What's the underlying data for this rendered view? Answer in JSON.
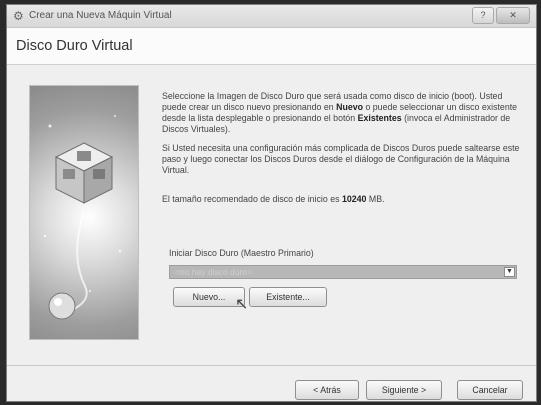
{
  "window": {
    "title": "Crear una Nueva Máquin Virtual",
    "controls": {
      "help": "?",
      "close": "✕"
    }
  },
  "page": {
    "title": "Disco Duro Virtual"
  },
  "description": {
    "p1": [
      "Seleccione la Imagen de Disco Duro que será usada como disco de inicio (boot).",
      "Usted puede crear un disco nuevo presionando en ",
      "Nuevo",
      " o puede seleccionar un disco existente desde la lista desplegable o presionando el botón ",
      "Existentes",
      " (invoca el Administrador de Discos Virtuales)."
    ],
    "p2": "Si Usted necesita una configuración más complicada de Discos Duros puede saltearse este paso y luego conectar los Discos Duros desde el diálogo de Configuración de la Máquina Virtual.",
    "p3_prefix": "El tamaño recomendado de disco de inicio es ",
    "p3_value": "10240",
    "p3_unit": " MB."
  },
  "boot_disk": {
    "label": "Iniciar Disco Duro (Maestro Primario)",
    "selected": "<no hay disco duro>",
    "new_button": "Nuevo...",
    "existing_button": "Existente..."
  },
  "footer": {
    "back": "< Atrás",
    "next": "Siguiente >",
    "cancel": "Cancelar"
  },
  "colors": {
    "combo_selected_bg": "#b7b7b7",
    "window_bg": "#efefef"
  }
}
